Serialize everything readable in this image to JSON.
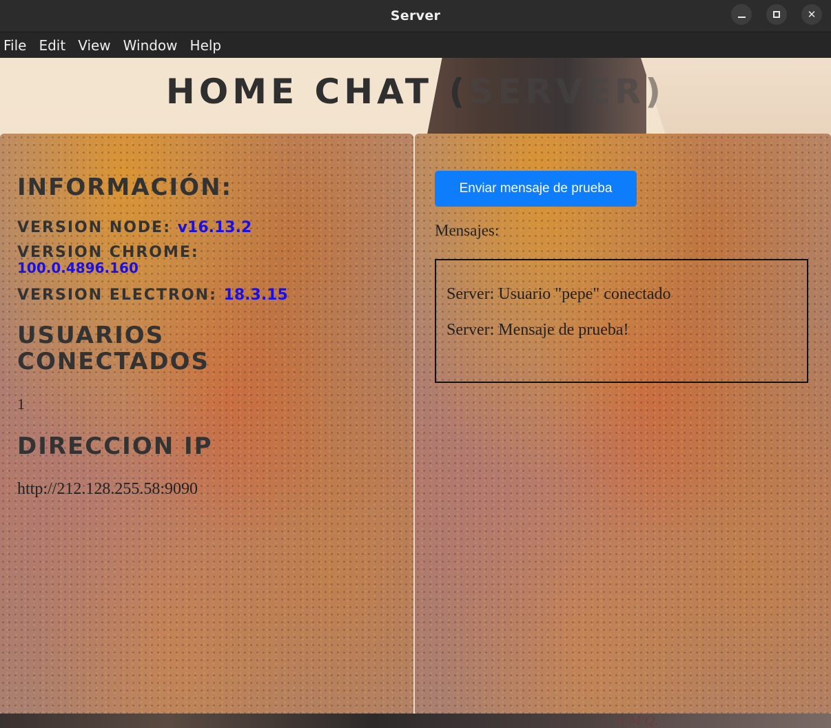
{
  "window": {
    "title": "Server",
    "minimize_glyph": "–",
    "close_glyph": "✕"
  },
  "menu": [
    "File",
    "Edit",
    "View",
    "Window",
    "Help"
  ],
  "app": {
    "title_main": "Home chat (",
    "title_faded": "server)",
    "signature": "R.M'Q."
  },
  "info": {
    "heading": "Información:",
    "node_label": "Version Node: ",
    "node_value": "v16.13.2",
    "chrome_label": "Version Chrome:",
    "chrome_value": "100.0.4896.160",
    "electron_label": "Version Electron: ",
    "electron_value": "18.3.15"
  },
  "users": {
    "heading": "Usuarios conectados",
    "count": "1"
  },
  "ip": {
    "heading": "Direccion IP",
    "value": "http://212.128.255.58:9090"
  },
  "chat": {
    "send_button": "Enviar mensaje de prueba",
    "messages_label": "Mensajes:",
    "messages": [
      "Server: Usuario \"pepe\" conectado",
      "Server: Mensaje de prueba!"
    ]
  },
  "colors": {
    "button": "#0d7dfc",
    "version_value": "#1a10e6",
    "heading_text": "#333333"
  }
}
